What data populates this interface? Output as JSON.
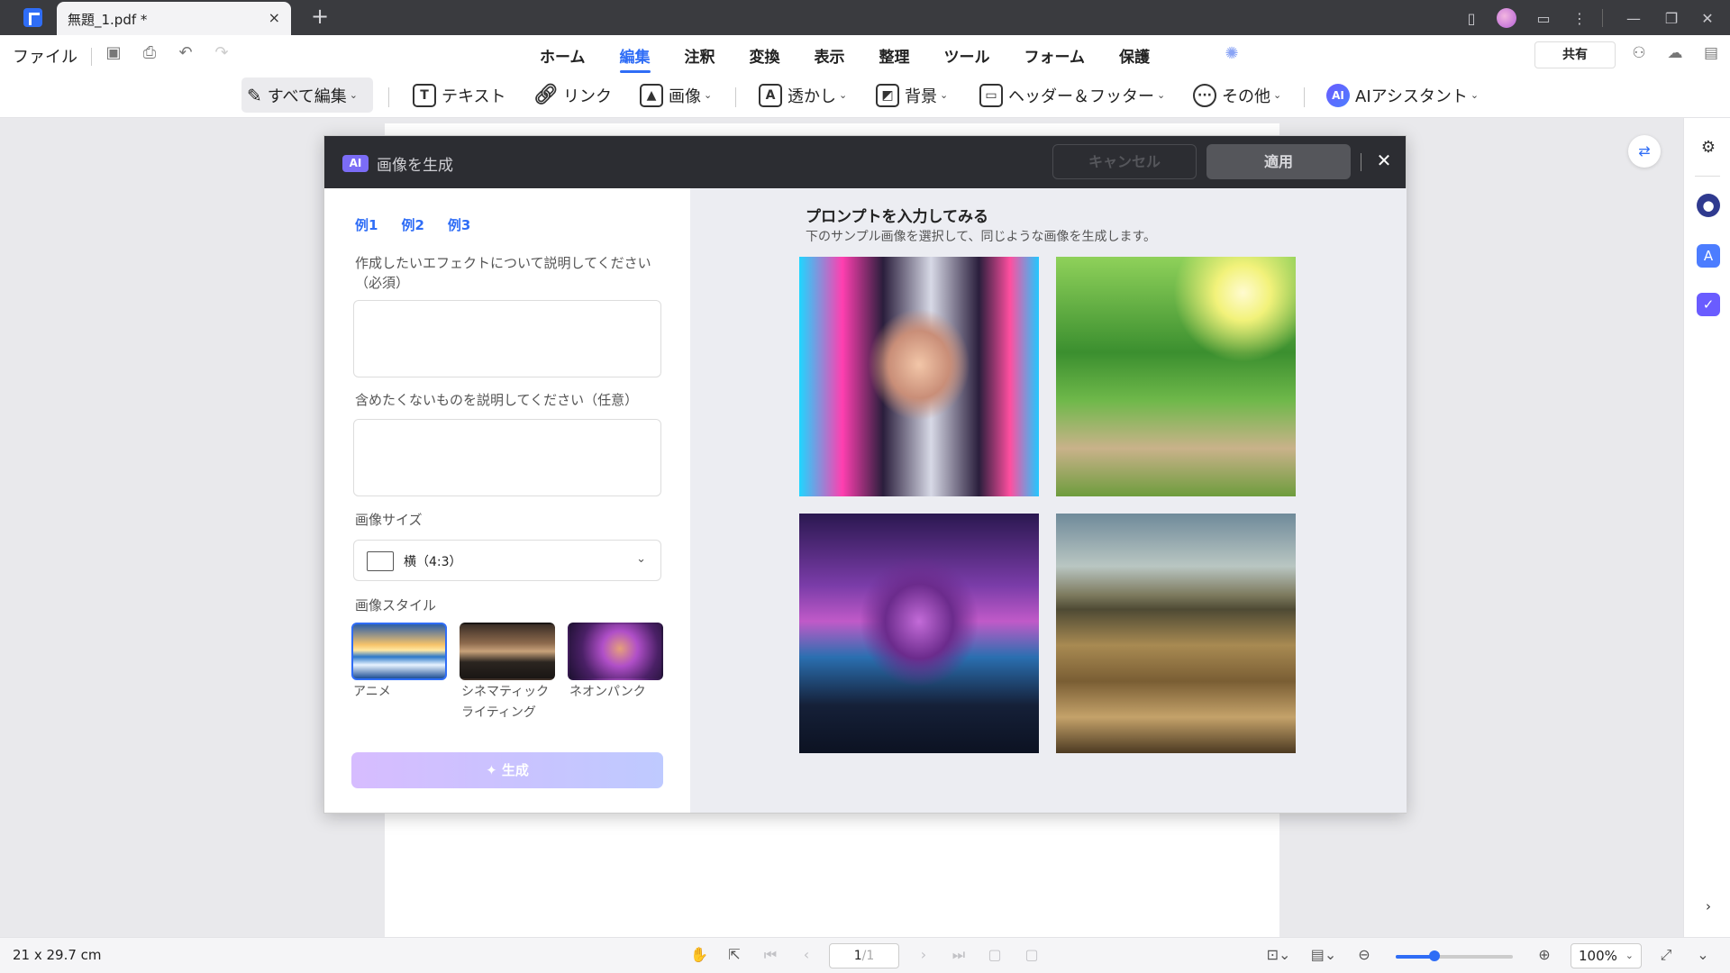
{
  "titlebar": {
    "tab_title": "無題_1.pdf *",
    "tab_close": "×",
    "new_tab": "+"
  },
  "menubar": {
    "file": "ファイル",
    "tabs": [
      {
        "label": "ホーム"
      },
      {
        "label": "編集",
        "active": true
      },
      {
        "label": "注釈"
      },
      {
        "label": "変換"
      },
      {
        "label": "表示"
      },
      {
        "label": "整理"
      },
      {
        "label": "ツール"
      },
      {
        "label": "フォーム"
      },
      {
        "label": "保護"
      }
    ],
    "share": "共有"
  },
  "toolbar": {
    "edit_all": "すべて編集",
    "text": "テキスト",
    "link": "リンク",
    "image": "画像",
    "watermark": "透かし",
    "background": "背景",
    "header_footer": "ヘッダー＆フッター",
    "more": "その他",
    "ai_assistant": "AIアシスタント",
    "ai_badge": "AI"
  },
  "dialog": {
    "badge": "AI",
    "title": "画像を生成",
    "cancel": "キャンセル",
    "apply": "適用",
    "close": "✕",
    "examples": [
      "例1",
      "例2",
      "例3"
    ],
    "effect_label": "作成したいエフェクトについて説明してください（必須）",
    "effect_value": "",
    "exclude_label": "含めたくないものを説明してください（任意）",
    "exclude_value": "",
    "size_label": "画像サイズ",
    "size_value": "横（4:3）",
    "style_label": "画像スタイル",
    "styles": [
      {
        "name": "アニメ",
        "selected": true
      },
      {
        "name": "シネマティックライティング",
        "selected": false
      },
      {
        "name": "ネオンパンク",
        "selected": false
      }
    ],
    "generate": "✦ 生成",
    "prompt_title": "プロンプトを入力してみる",
    "prompt_subtitle": "下のサンプル画像を選択して、同じような画像を生成します。"
  },
  "statusbar": {
    "page_size": "21 x 29.7 cm",
    "page_current": "1",
    "page_total": "/1",
    "zoom": "100%",
    "zoom_level": 0.33
  },
  "colors": {
    "accent": "#2f6df6",
    "titlebar": "#3a3b3f",
    "dialog_header": "#2c2d32"
  }
}
